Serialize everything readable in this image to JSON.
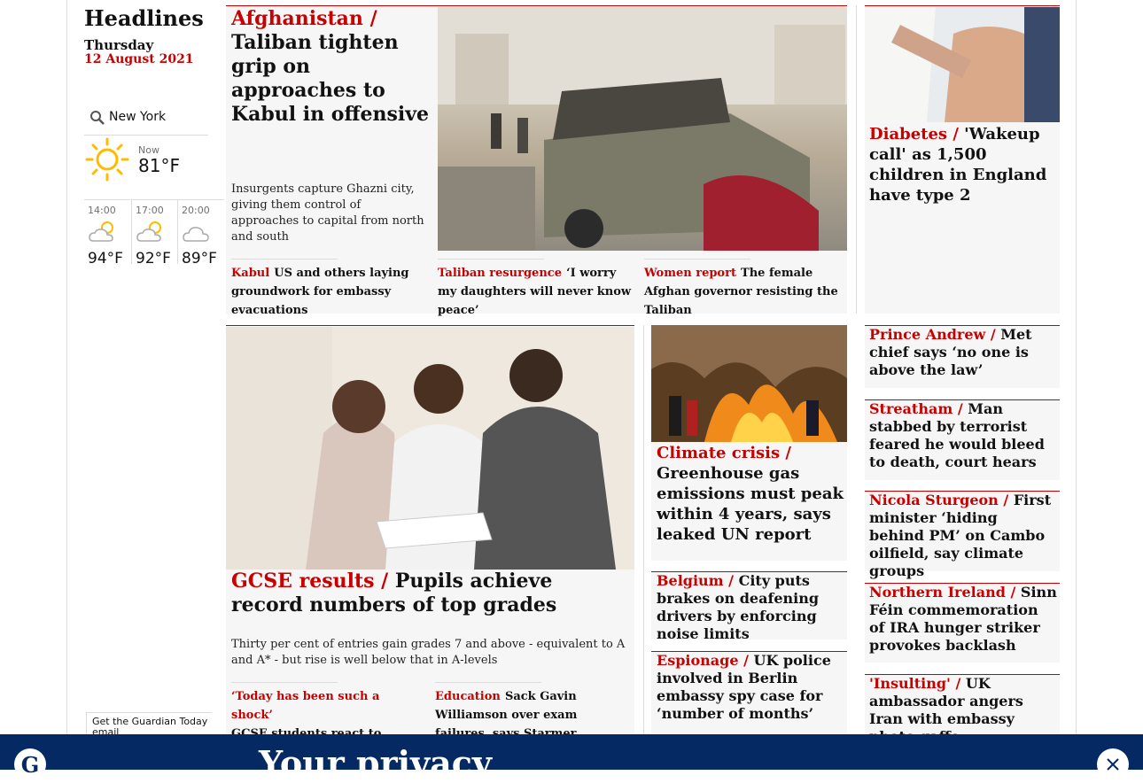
{
  "sidebar": {
    "section_title": "Headlines",
    "weekday": "Thursday",
    "date": "12 August 2021",
    "location": "New York",
    "now_label": "Now",
    "now_temp": "81°F",
    "forecast": [
      {
        "time": "14:00",
        "temp": "94°F",
        "icon": "partly-sunny-icon"
      },
      {
        "time": "17:00",
        "temp": "92°F",
        "icon": "partly-sunny-icon"
      },
      {
        "time": "20:00",
        "temp": "89°F",
        "icon": "cloud-icon"
      }
    ],
    "email_promo": "Get the Guardian Today email"
  },
  "lead": {
    "kicker": "Afghanistan /",
    "headline": "Taliban tighten grip on approaches to Kabul in offensive",
    "standfirst": "Insurgents capture Ghazni city, giving them control of approaches to capital from north and south",
    "sublinks": [
      {
        "kicker": "Kabul",
        "text": "US and others laying groundwork for embassy evacuations"
      },
      {
        "kicker": "Taliban resurgence",
        "text": "‘I worry my daughters will never know peace’"
      },
      {
        "kicker": "Women report",
        "text": "The female Afghan governor resisting the Taliban"
      }
    ]
  },
  "right_top": {
    "kicker": "Diabetes /",
    "headline": "'Wakeup call' as 1,500 children in England have type 2"
  },
  "gcse": {
    "kicker": "GCSE results /",
    "headline": "Pupils achieve record numbers of top grades",
    "standfirst": "Thirty per cent of entries gain grades 7 and above - equivalent to A and A* - but rise is well below that in A-levels",
    "sublinks": [
      {
        "kicker": "‘Today has been such a shock’",
        "text": "GCSE students react to stellar results"
      },
      {
        "kicker": "Education",
        "text": "Sack Gavin Williamson over exam failures, says Starmer"
      }
    ]
  },
  "climate": {
    "kicker": "Climate crisis /",
    "headline": "Greenhouse gas emissions must peak within 4 years, says leaked UN report"
  },
  "middle_stories": [
    {
      "kicker": "Belgium /",
      "headline": "City puts brakes on deafening drivers by enforcing noise limits"
    },
    {
      "kicker": "Espionage /",
      "headline": "UK police involved in Berlin embassy spy case for ‘number of months’"
    }
  ],
  "right_stories": [
    {
      "kicker": "Prince Andrew /",
      "headline": "Met chief says ‘no one is above the law’"
    },
    {
      "kicker": "Streatham /",
      "headline": "Man stabbed by terrorist feared he would bleed to death, court hears"
    },
    {
      "kicker": "Nicola Sturgeon /",
      "headline": "First minister ‘hiding behind PM’ on Cambo oilfield, say climate groups"
    },
    {
      "kicker": "Northern Ireland /",
      "headline": "Sinn Féin commemoration of IRA hunger striker provokes backlash"
    },
    {
      "kicker": "'Insulting'  /",
      "headline": "UK ambassador angers Iran with embassy photo gaffe"
    }
  ],
  "privacy_banner": {
    "title": "Your privacy"
  },
  "colors": {
    "accent": "#c70000",
    "card_bg": "#f6f6f6",
    "brand_blue": "#052962"
  }
}
